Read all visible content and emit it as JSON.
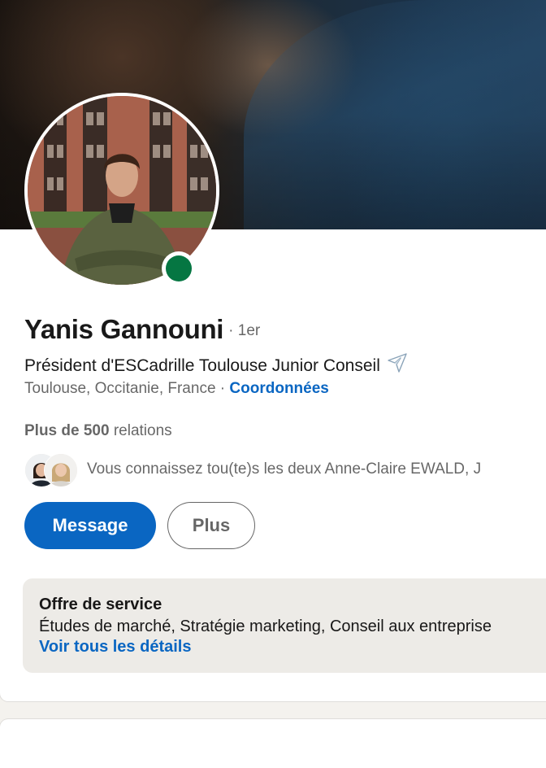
{
  "profile": {
    "name": "Yanis Gannouni",
    "degree": "· 1er",
    "headline": "Président d'ESCadrille Toulouse Junior Conseil",
    "headline_emoji": "airplane-icon",
    "location": "Toulouse, Occitanie, France",
    "location_separator": " · ",
    "contact_link": "Coordonnées",
    "online_status_color": "#057642"
  },
  "connections": {
    "prefix": "Plus de 500",
    "suffix": " relations"
  },
  "mutual": {
    "text": "Vous connaissez tou(te)s les deux Anne-Claire EWALD, J"
  },
  "actions": {
    "message_label": "Message",
    "more_label": "Plus"
  },
  "service": {
    "title": "Offre de service",
    "list": "Études de marché, Stratégie marketing, Conseil aux entreprise",
    "link": "Voir tous les détails"
  },
  "colors": {
    "brand": "#0a66c2",
    "service_bg": "#edebe7",
    "page_bg": "#f4f2ee"
  }
}
